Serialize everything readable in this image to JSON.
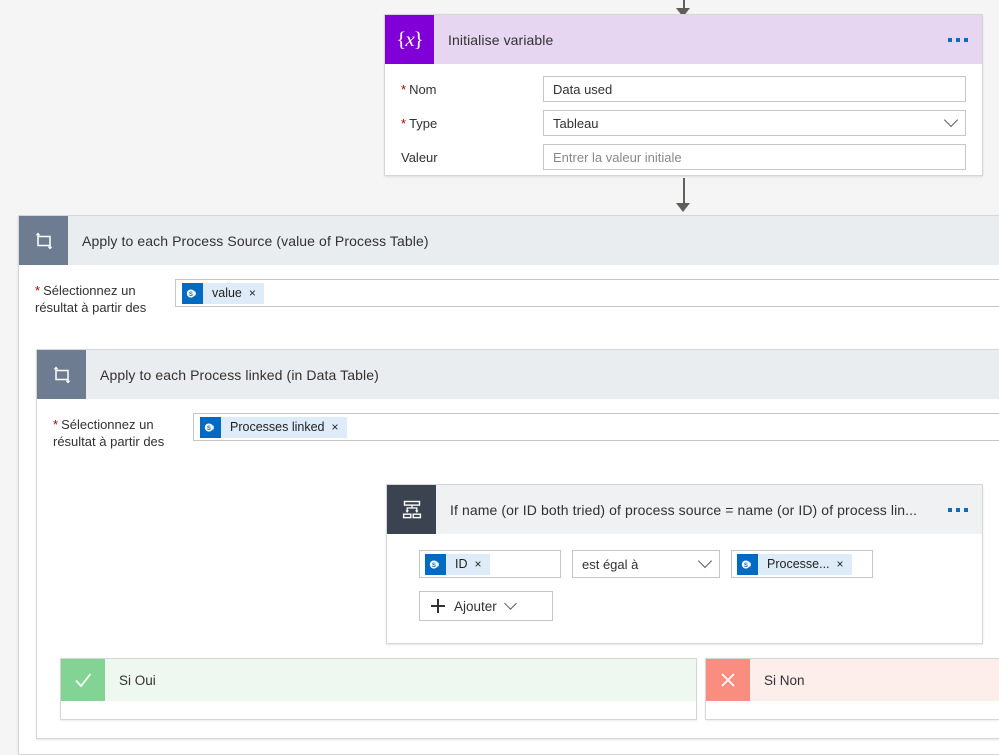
{
  "canvas": {
    "background_color": "#f5f5f5"
  },
  "initialise_variable": {
    "icon": "variable-braces-icon",
    "title": "Initialise variable",
    "header_color": "#e7d6f2",
    "icon_color": "#8000d7",
    "menu": "ellipsis-menu",
    "fields": [
      {
        "label": "Nom",
        "required": true,
        "value": "Data used",
        "type": "text"
      },
      {
        "label": "Type",
        "required": true,
        "value": "Tableau",
        "type": "dropdown"
      },
      {
        "label": "Valeur",
        "required": false,
        "value": "Entrer la valeur initiale",
        "type": "placeholder"
      }
    ]
  },
  "outer_loop": {
    "icon": "loop-icon",
    "title": "Apply to each Process Source (value of Process Table)",
    "header_color": "#eaedf0",
    "icon_color": "#6e7c91",
    "field_label": "Sélectionnez un résultat à partir des",
    "field_required": true,
    "token": {
      "icon": "sharepoint-icon",
      "label": "value",
      "remove": "×"
    }
  },
  "inner_loop": {
    "icon": "loop-icon",
    "title": "Apply to each Process linked (in Data Table)",
    "header_color": "#eaedf0",
    "icon_color": "#6e7c91",
    "field_label": "Sélectionnez un résultat à partir des",
    "field_required": true,
    "token": {
      "icon": "sharepoint-icon",
      "label": "Processes linked",
      "remove": "×"
    }
  },
  "condition": {
    "icon": "condition-branch-icon",
    "title": "If name (or ID both tried) of process source = name (or ID) of process lin...",
    "header_color": "#eff1f3",
    "icon_color": "#3b4250",
    "menu": "ellipsis-menu",
    "left_operand": {
      "icon": "sharepoint-icon",
      "label": "ID",
      "remove": "×"
    },
    "operator": "est égal à",
    "right_operand": {
      "icon": "sharepoint-icon",
      "label": "Processe...",
      "remove": "×"
    },
    "add_button": "Ajouter"
  },
  "branches": {
    "yes": {
      "icon": "check-icon",
      "label": "Si Oui",
      "icon_color": "#83d494",
      "header_color": "#eef8f0"
    },
    "no": {
      "icon": "cross-icon",
      "label": "Si Non",
      "icon_color": "#f98e80",
      "header_color": "#fdeeec"
    }
  },
  "colors": {
    "accent_blue": "#0f6cbd",
    "required_red": "#a80000",
    "sharepoint_blue": "#036ac4",
    "chip_background": "#deecf9"
  }
}
